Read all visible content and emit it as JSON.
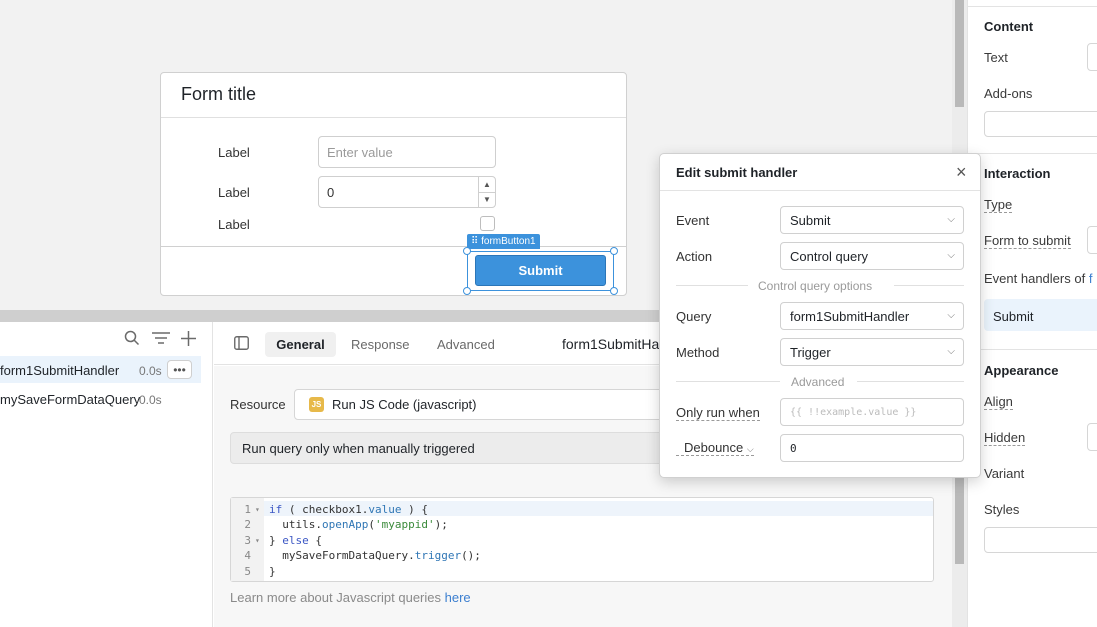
{
  "form": {
    "title": "Form title",
    "field1_label": "Label",
    "field1_placeholder": "Enter value",
    "field2_label": "Label",
    "field2_value": "0",
    "field3_label": "Label",
    "button_tag": "formButton1",
    "submit_label": "Submit"
  },
  "query_list": {
    "items": [
      {
        "name": "form1SubmitHandler",
        "time": "0.0s"
      },
      {
        "name": "mySaveFormDataQuery",
        "time": "0.0s"
      }
    ],
    "more": "•••"
  },
  "editor": {
    "tabs": [
      "General",
      "Response",
      "Advanced"
    ],
    "query_name": "form1SubmitHa",
    "resource_label": "Resource",
    "resource_badge": "JS",
    "resource_value": "Run JS Code (javascript)",
    "trigger_value": "Run query only when manually triggered",
    "learn_more_text": "Learn more about Javascript queries",
    "learn_more_link": "here",
    "code_lines": [
      "1",
      "2",
      "3",
      "4",
      "5"
    ]
  },
  "modal": {
    "title": "Edit submit handler",
    "event_label": "Event",
    "event_value": "Submit",
    "action_label": "Action",
    "action_value": "Control query",
    "control_section": "Control query options",
    "query_label": "Query",
    "query_value": "form1SubmitHandler",
    "method_label": "Method",
    "method_value": "Trigger",
    "advanced_section": "Advanced",
    "only_run_label": "Only run when",
    "only_run_placeholder": "{{ !!example.value }}",
    "debounce_label": "Debounce",
    "debounce_value": "0"
  },
  "inspector": {
    "content_heading": "Content",
    "text_label": "Text",
    "addons_label": "Add-ons",
    "interaction_heading": "Interaction",
    "type_label": "Type",
    "form_to_submit_label": "Form to submit",
    "event_handlers_label": "Event handlers of",
    "event_handlers_suffix": "f",
    "handler_item": "Submit",
    "appearance_heading": "Appearance",
    "align_label": "Align",
    "hidden_label": "Hidden",
    "variant_label": "Variant",
    "styles_label": "Styles"
  },
  "colors": {
    "accent": "#3c92dc",
    "selected_row": "#eaf3fc"
  }
}
